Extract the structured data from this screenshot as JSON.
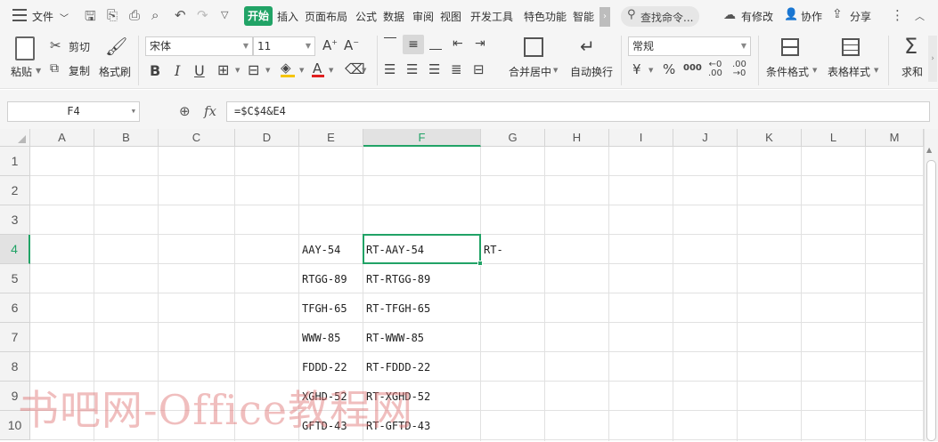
{
  "menu": {
    "file": "文件",
    "tabs": [
      "开始",
      "插入",
      "页面布局",
      "公式",
      "数据",
      "审阅",
      "视图",
      "开发工具",
      "特色功能",
      "智能"
    ],
    "search": "查找命令...",
    "modified": "有修改",
    "collab": "协作",
    "share": "分享"
  },
  "ribbon": {
    "paste": "粘贴",
    "cut": "剪切",
    "copy": "复制",
    "format_painter": "格式刷",
    "font_name": "宋体",
    "font_size": "11",
    "number_format": "常规",
    "merge_center": "合并居中",
    "wrap_text": "自动换行",
    "cond_format": "条件格式",
    "table_style": "表格样式",
    "sum": "求和",
    "bold": "B",
    "italic": "I",
    "underline": "U",
    "currency": "¥",
    "percent": "%",
    "thousands": "000",
    "font_color_letter": "A"
  },
  "formula_bar": {
    "name_box": "F4",
    "fx": "fx",
    "formula": "=$C$4&E4"
  },
  "grid": {
    "columns": [
      "A",
      "B",
      "C",
      "D",
      "E",
      "F",
      "G",
      "H",
      "I",
      "J",
      "K",
      "L",
      "M"
    ],
    "rows": [
      "1",
      "2",
      "3",
      "4",
      "5",
      "6",
      "7",
      "8",
      "9",
      "10"
    ],
    "selected_column": "F",
    "selected_row": "4",
    "column_e": [
      "AAY-54",
      "RTGG-89",
      "TFGH-65",
      "WWW-85",
      "FDDD-22",
      "XGHD-52",
      "GFTD-43"
    ],
    "column_f": [
      "RT-AAY-54",
      "RT-RTGG-89",
      "RT-TFGH-65",
      "RT-WWW-85",
      "RT-FDDD-22",
      "RT-XGHD-52",
      "RT-GFTD-43"
    ],
    "g4": "RT-"
  },
  "watermark": "书吧网-Office教程网",
  "colors": {
    "accent": "#21a366"
  }
}
